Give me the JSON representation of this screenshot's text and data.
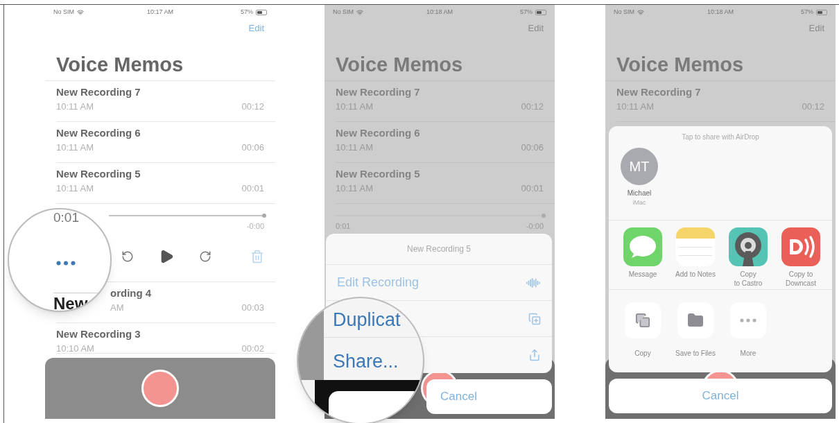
{
  "screens": [
    {
      "kind": "player",
      "dimmed": false,
      "status": {
        "carrier": "No SIM",
        "time": "10:17 AM",
        "battery": "57%"
      },
      "edit": "Edit",
      "title": "Voice Memos",
      "recordings": [
        {
          "name": "New Recording 7",
          "time": "10:11 AM",
          "duration": "00:12"
        },
        {
          "name": "New Recording 6",
          "time": "10:11 AM",
          "duration": "00:06"
        },
        {
          "name": "New Recording 5",
          "time": "10:11 AM",
          "duration": "00:01"
        }
      ],
      "player": {
        "elapsed": "0:01",
        "remaining": "-0:00",
        "level": 1
      },
      "recordings_below": [
        {
          "name": "ording 4",
          "time": "AM",
          "duration": "00:03"
        },
        {
          "name": "New Recording 3",
          "time": "10:10 AM",
          "duration": "00:02"
        }
      ],
      "magnifier": {
        "title_part": "New"
      }
    },
    {
      "kind": "actions",
      "dimmed": true,
      "status": {
        "carrier": "No SIM",
        "time": "10:18 AM",
        "battery": "57%"
      },
      "edit": "Edit",
      "title": "Voice Memos",
      "recordings": [
        {
          "name": "New Recording 7",
          "time": "10:11 AM",
          "duration": "00:12"
        },
        {
          "name": "New Recording 6",
          "time": "10:11 AM",
          "duration": "00:06"
        },
        {
          "name": "New Recording 5",
          "time": "10:11 AM",
          "duration": "00:01"
        }
      ],
      "player": {
        "elapsed": "0:01",
        "remaining": "-0:00",
        "level": 1
      },
      "sheet": {
        "title": "New Recording 5",
        "items": [
          {
            "label": "Edit Recording",
            "magnified": false
          },
          {
            "label": "Duplicat",
            "magnified": true
          },
          {
            "label": "Share...",
            "magnified": true
          }
        ],
        "cancel": "Cancel"
      }
    },
    {
      "kind": "share",
      "dimmed": true,
      "status": {
        "carrier": "No SIM",
        "time": "10:18 AM",
        "battery": "57%"
      },
      "edit": "Edit",
      "title": "Voice Memos",
      "recordings": [
        {
          "name": "New Recording 7",
          "time": "10:11 AM",
          "duration": "00:12"
        }
      ],
      "sheet": {
        "airdrop_hint": "Tap to share with AirDrop",
        "contacts": [
          {
            "initials": "MT",
            "name": "Michael",
            "device": "iMac"
          }
        ],
        "apps": [
          {
            "lines": [
              "Message"
            ]
          },
          {
            "lines": [
              "Add to Notes"
            ]
          },
          {
            "lines": [
              "Copy",
              "to Castro"
            ]
          },
          {
            "lines": [
              "Copy to",
              "Downcast"
            ]
          }
        ],
        "actions": [
          {
            "label": "Copy"
          },
          {
            "label": "Save to Files"
          },
          {
            "label": "More"
          }
        ],
        "cancel": "Cancel"
      }
    }
  ]
}
